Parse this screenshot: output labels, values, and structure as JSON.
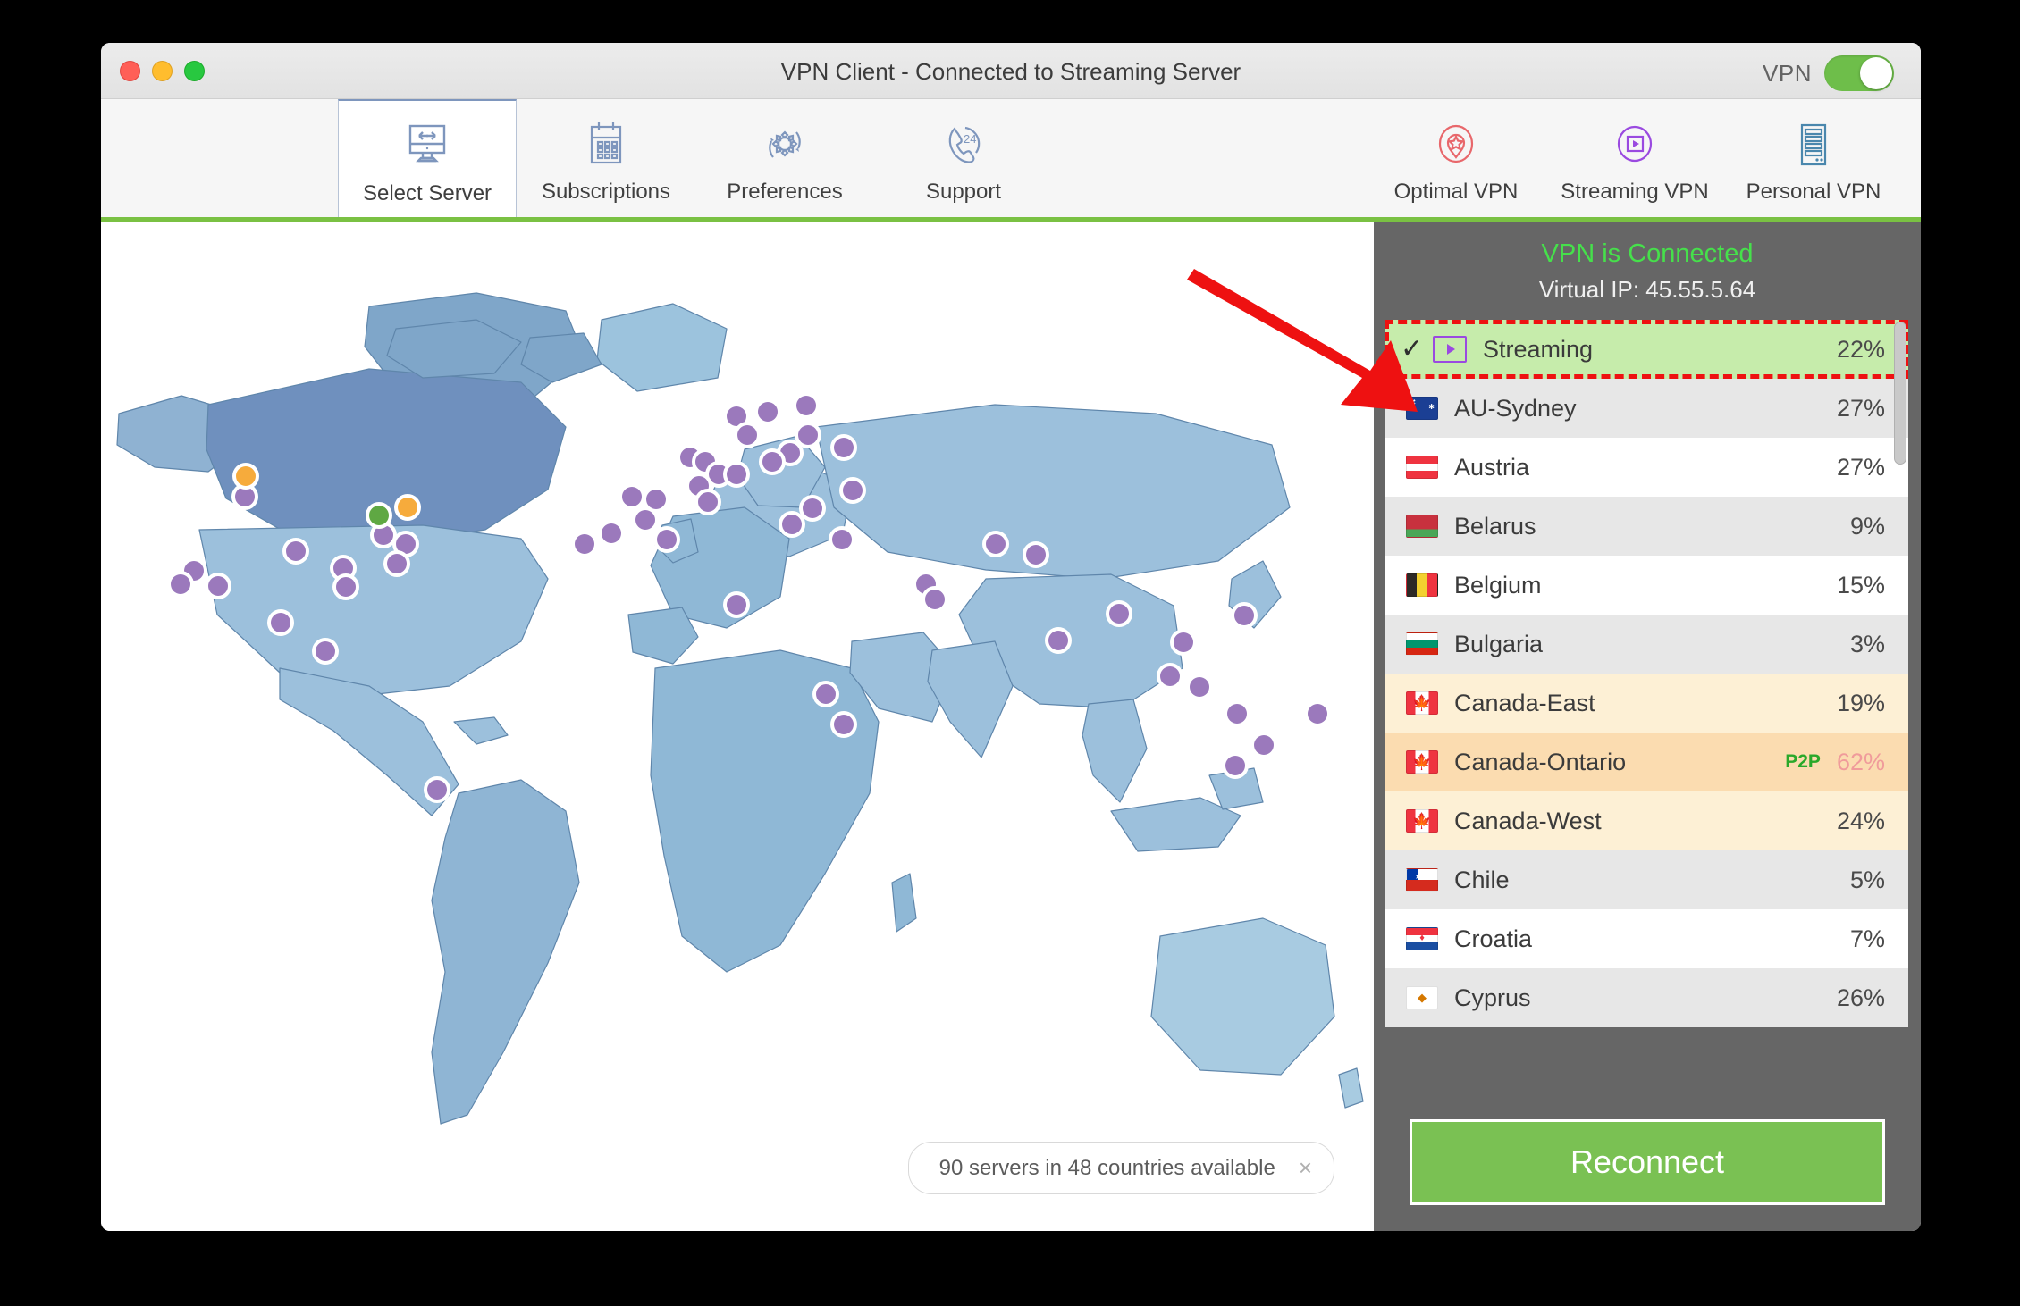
{
  "window": {
    "title": "VPN Client - Connected to Streaming Server",
    "traffic_lights": [
      "close",
      "minimize",
      "zoom"
    ],
    "vpn_switch_label": "VPN",
    "vpn_switch_state": "on",
    "accent_green": "#7ac143",
    "connected_green": "#46e04b"
  },
  "toolbar": {
    "left_items": [
      {
        "label": "Select Server",
        "icon": "monitor-arrows-icon",
        "selected": true
      },
      {
        "label": "Subscriptions",
        "icon": "calendar-icon",
        "selected": false
      },
      {
        "label": "Preferences",
        "icon": "gear-refresh-icon",
        "selected": false
      },
      {
        "label": "Support",
        "icon": "phone-24-icon",
        "selected": false
      }
    ],
    "right_items": [
      {
        "label": "Optimal VPN",
        "icon": "pin-star-icon",
        "color": "#e8676b"
      },
      {
        "label": "Streaming VPN",
        "icon": "play-circle-icon",
        "color": "#9a4ae0"
      },
      {
        "label": "Personal VPN",
        "icon": "server-rack-icon",
        "color": "#4a87ad"
      }
    ]
  },
  "map": {
    "status_pill": "90 servers in 48 countries available",
    "pill_close_icon": "close-icon",
    "marker_colors": {
      "server": "#9b79bc",
      "busy": "#f6ab3c",
      "connected": "#5fa843"
    },
    "ocean": "#ffffff",
    "land_light": "#a3c7df",
    "land_mid": "#8fb8d6",
    "land_dark": "#6f90be"
  },
  "annotation": {
    "arrow_color": "#ee1111",
    "points_to": "Streaming"
  },
  "panel": {
    "status": "VPN is Connected",
    "virtual_ip": "Virtual IP: 45.55.5.64",
    "reconnect_label": "Reconnect",
    "servers": [
      {
        "name": "Streaming",
        "load": "22%",
        "icon": "play-box-icon",
        "checked": true,
        "style": "selected",
        "badge": ""
      },
      {
        "name": "AU-Sydney",
        "load": "27%",
        "flag": "au",
        "style": "grey",
        "badge": ""
      },
      {
        "name": "Austria",
        "load": "27%",
        "flag": "at",
        "style": "white",
        "badge": ""
      },
      {
        "name": "Belarus",
        "load": "9%",
        "flag": "by",
        "style": "grey",
        "badge": ""
      },
      {
        "name": "Belgium",
        "load": "15%",
        "flag": "be",
        "style": "white",
        "badge": ""
      },
      {
        "name": "Bulgaria",
        "load": "3%",
        "flag": "bg",
        "style": "grey",
        "badge": ""
      },
      {
        "name": "Canada-East",
        "load": "19%",
        "flag": "ca",
        "style": "cream",
        "badge": ""
      },
      {
        "name": "Canada-Ontario",
        "load": "62%",
        "flag": "ca",
        "style": "cream2",
        "badge": "P2P"
      },
      {
        "name": "Canada-West",
        "load": "24%",
        "flag": "ca",
        "style": "cream",
        "badge": ""
      },
      {
        "name": "Chile",
        "load": "5%",
        "flag": "cl",
        "style": "grey",
        "badge": ""
      },
      {
        "name": "Croatia",
        "load": "7%",
        "flag": "hr",
        "style": "white",
        "badge": ""
      },
      {
        "name": "Cyprus",
        "load": "26%",
        "flag": "cy",
        "style": "grey",
        "badge": ""
      }
    ]
  }
}
